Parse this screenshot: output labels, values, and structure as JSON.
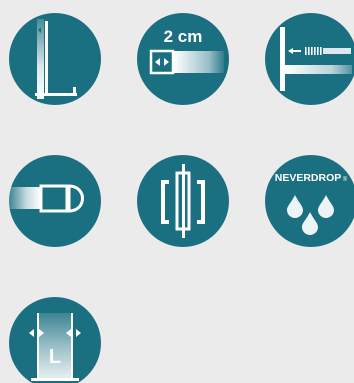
{
  "colors": {
    "page_background": "#ebebeb",
    "circle": "#1a6f81",
    "symbol": "#ffffff"
  },
  "icons": [
    {
      "name": "glass-panel-profile-icon"
    },
    {
      "name": "adjustment-2cm-icon",
      "label": "2 cm"
    },
    {
      "name": "wall-profile-extension-icon"
    },
    {
      "name": "magnetic-seal-icon"
    },
    {
      "name": "door-hinge-profile-icon"
    },
    {
      "name": "neverdrop-coating-icon",
      "label": "NEVERDROP",
      "mark": "®"
    },
    {
      "name": "width-adjustable-l-icon",
      "label": "L"
    }
  ]
}
